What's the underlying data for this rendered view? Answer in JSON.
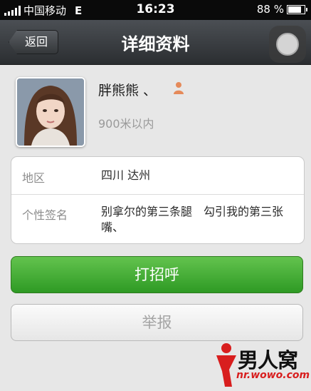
{
  "status_bar": {
    "carrier": "中国移动",
    "network": "E",
    "time": "16:23",
    "battery_text": "88 %",
    "battery_level": 0.88
  },
  "nav": {
    "back_label": "返回",
    "title": "详细资料"
  },
  "profile": {
    "name": "胖熊熊 、",
    "distance": "900米以内",
    "gender_icon": "person-icon"
  },
  "info": {
    "region_label": "地区",
    "region_value": "四川 达州",
    "signature_label": "个性签名",
    "signature_value": "别拿尔的第三条腿　勾引我的第三张嘴、"
  },
  "actions": {
    "greet_label": "打招呼",
    "report_label": "举报"
  },
  "watermark": {
    "text": "男人窝",
    "url": "nr.wowo.com"
  },
  "colors": {
    "greet_button": "#3aa82c",
    "navbar": "#3a3d41",
    "background": "#e7e7e7"
  }
}
